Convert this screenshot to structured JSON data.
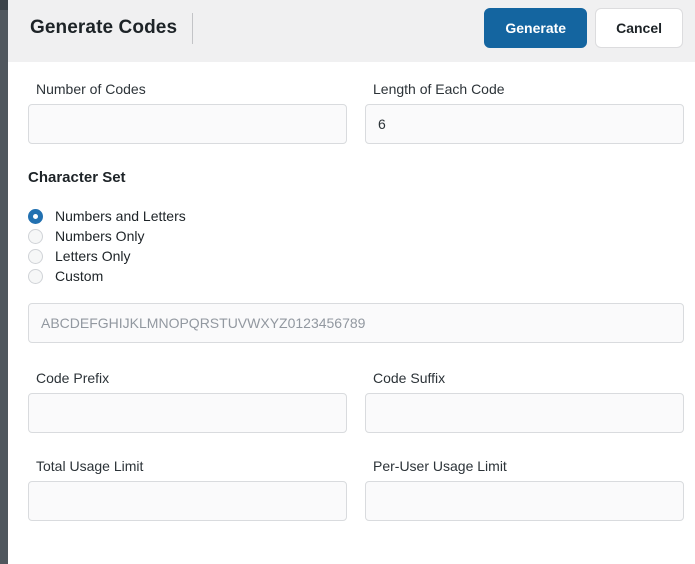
{
  "header": {
    "title": "Generate Codes",
    "generate_label": "Generate",
    "cancel_label": "Cancel"
  },
  "form": {
    "number_of_codes": {
      "label": "Number of Codes",
      "value": ""
    },
    "length_of_each_code": {
      "label": "Length of Each Code",
      "value": "6"
    },
    "character_set": {
      "label": "Character Set",
      "options": [
        {
          "label": "Numbers and Letters",
          "selected": true
        },
        {
          "label": "Numbers Only",
          "selected": false
        },
        {
          "label": "Letters Only",
          "selected": false
        },
        {
          "label": "Custom",
          "selected": false
        }
      ],
      "custom_charset_placeholder": "ABCDEFGHIJKLMNOPQRSTUVWXYZ0123456789"
    },
    "code_prefix": {
      "label": "Code Prefix",
      "value": ""
    },
    "code_suffix": {
      "label": "Code Suffix",
      "value": ""
    },
    "total_usage_limit": {
      "label": "Total Usage Limit",
      "value": ""
    },
    "per_user_usage_limit": {
      "label": "Per-User Usage Limit",
      "value": ""
    }
  },
  "colors": {
    "primary_button": "#1465a0",
    "radio_selected": "#2271b1",
    "header_bg": "#f0f0f1",
    "sidebar_strip": "#50575e",
    "input_bg": "#fafafb",
    "input_border": "#d9dbde"
  }
}
